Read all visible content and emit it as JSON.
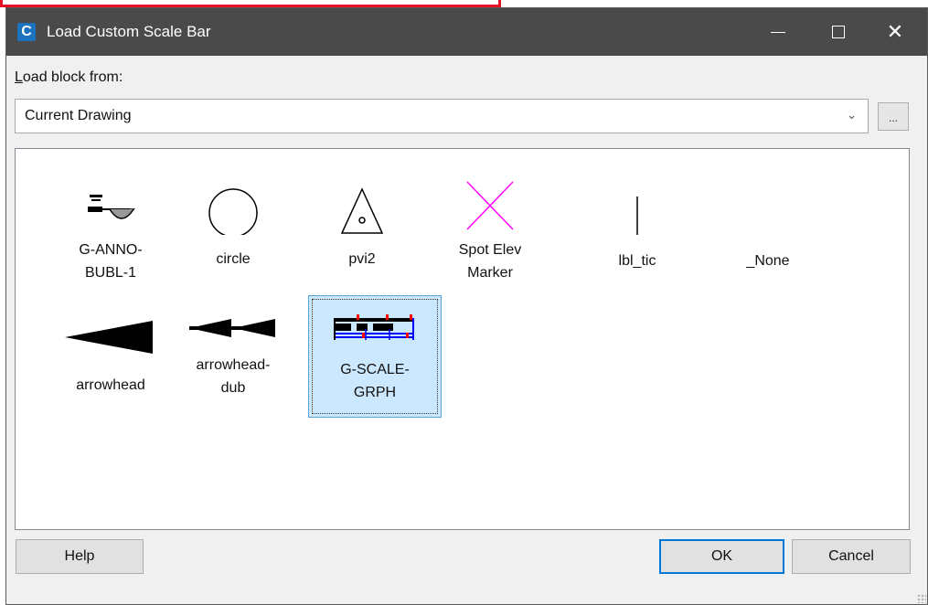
{
  "window": {
    "title": "Load Custom Scale Bar",
    "app_icon_letter": "C",
    "icons": {
      "app": "civil3d-app-icon",
      "minimize": "minimize-icon",
      "maximize": "maximize-icon",
      "close": "close-icon"
    }
  },
  "load_block": {
    "label_access_key": "L",
    "label_rest": "oad block from:",
    "selected": "Current Drawing",
    "browse_label": "..."
  },
  "blocks": [
    {
      "name": "G-ANNO-\nBUBL-1",
      "lines": [
        "G-ANNO-",
        "BUBL-1"
      ],
      "icon": "anno-bubble-icon",
      "selected": false
    },
    {
      "name": "circle",
      "lines": [
        "circle"
      ],
      "icon": "circle-icon",
      "selected": false
    },
    {
      "name": "pvi2",
      "lines": [
        "pvi2"
      ],
      "icon": "triangle-dot-icon",
      "selected": false
    },
    {
      "name": "Spot Elev Marker",
      "lines": [
        "Spot Elev",
        "Marker"
      ],
      "icon": "x-marker-icon",
      "selected": false
    },
    {
      "name": "lbl_tic",
      "lines": [
        "lbl_tic"
      ],
      "icon": "tick-line-icon",
      "selected": false
    },
    {
      "name": "_None",
      "lines": [
        "_None"
      ],
      "icon": "none-icon",
      "selected": false
    },
    {
      "name": "arrowhead",
      "lines": [
        "arrowhead"
      ],
      "icon": "arrowhead-icon",
      "selected": false
    },
    {
      "name": "arrowhead-dub",
      "lines": [
        "arrowhead-",
        "dub"
      ],
      "icon": "arrowhead-double-icon",
      "selected": false
    },
    {
      "name": "G-SCALE-GRPH",
      "lines": [
        "G-SCALE-",
        "GRPH"
      ],
      "icon": "scale-bar-icon",
      "selected": true
    }
  ],
  "buttons": {
    "help": "Help",
    "ok": "OK",
    "cancel": "Cancel"
  },
  "colors": {
    "titlebar": "#4a4a4a",
    "selection": "#cce8ff",
    "accent": "#0078d7",
    "magenta": "#ff00ff"
  }
}
